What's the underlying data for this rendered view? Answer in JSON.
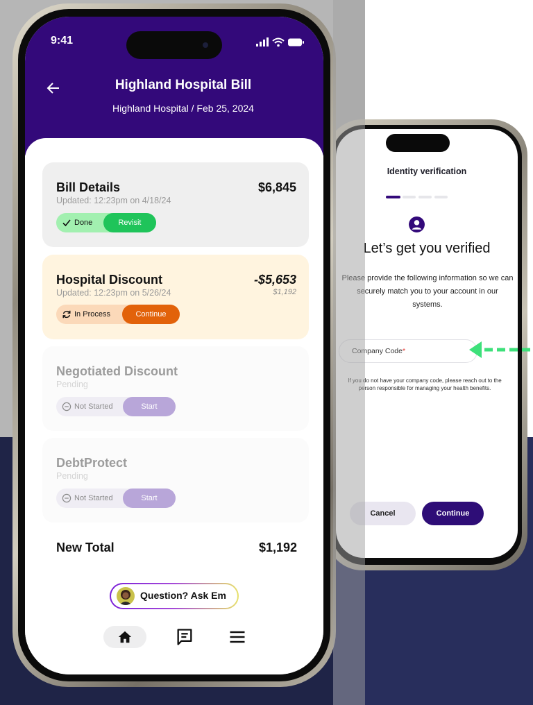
{
  "phone_left": {
    "status_time": "9:41",
    "header": {
      "title": "Highland Hospital Bill",
      "subtitle": "Highland Hospital  /  Feb 25, 2024"
    },
    "cards": [
      {
        "title": "Bill Details",
        "amount": "$6,845",
        "updated": "Updated: 12:23pm on 4/18/24",
        "state_label": "Done",
        "action_label": "Revisit"
      },
      {
        "title": "Hospital Discount",
        "amount": "-$5,653",
        "sub_amount": "$1,192",
        "updated": "Updated: 12:23pm on 5/26/24",
        "state_label": "In Process",
        "action_label": "Continue"
      },
      {
        "title": "Negotiated Discount",
        "updated": "Pending",
        "state_label": "Not Started",
        "action_label": "Start"
      },
      {
        "title": "DebtProtect",
        "updated": "Pending",
        "state_label": "Not Started",
        "action_label": "Start"
      }
    ],
    "total": {
      "label": "New Total",
      "value": "$1,192"
    },
    "ask_button": "Question? Ask Em",
    "nav": [
      "home-icon",
      "message-icon",
      "menu-icon"
    ]
  },
  "phone_right": {
    "title": "Identity verification",
    "steps": {
      "total": 4,
      "current": 1
    },
    "heading": "Let’s get you verified",
    "description": "Please provide the following information so we can securely match you to your account in our systems.",
    "company_field_label": "Company Code",
    "required_marker": "*",
    "help_text": "If you do not have your company code, please reach out to the person responsible for managing your health benefits.",
    "cancel_label": "Cancel",
    "continue_label": "Continue"
  },
  "colors": {
    "header_purple": "#33097a",
    "done_green": "#1fc45a",
    "process_orange": "#e2620a",
    "start_lavender": "#b8a6d9",
    "arrow_green": "#3de07a"
  }
}
